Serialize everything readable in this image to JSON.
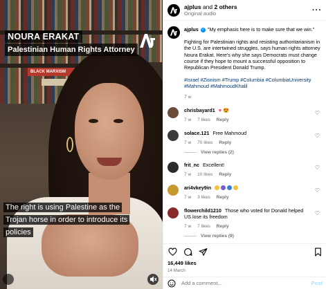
{
  "video": {
    "name_caption": "NOURA ERAKAT",
    "role_caption": "Palestinian Human Rights Attorney",
    "subtitle": "The right is using Palestine as the Trojan horse in order to introduce its policies",
    "book_spine_text": "BLACK MARXISM"
  },
  "header": {
    "username": "ajplus",
    "and_text": "and",
    "others_text": "2 others",
    "audio_label": "Original audio",
    "more_label": "···"
  },
  "post": {
    "username": "ajplus",
    "quote": "\"My emphasis here is to make sure that we win.\"",
    "body": "Fighting for Palestinian rights and resisting authoritarianism in the U.S. are intertwined struggles, says human rights attorney Noura Erakat. Here's why she says Democrats must change course if they hope to mount a successful opposition to Republican President Donald Trump.",
    "hashtags": "#Israel #Zionism #Trump #Columbia #ColumbiaUniversity #Mahmoud #MahmoudKhalil",
    "age": "7 w"
  },
  "comments": [
    {
      "user": "chrisbayard1",
      "text": "",
      "age": "7 w",
      "likes": "7 likes",
      "reply": "Reply",
      "replies": "",
      "avatar_color": "#6b4b3a"
    },
    {
      "user": "solace.121",
      "text": "Free Mahmoud",
      "age": "7 w",
      "likes": "70 likes",
      "reply": "Reply",
      "replies": "View replies (2)",
      "avatar_color": "#3a3a3a"
    },
    {
      "user": "frit_nc",
      "text": "Excellent!",
      "age": "7 w",
      "likes": "10 likes",
      "reply": "Reply",
      "replies": "",
      "avatar_color": "#2b2b2b"
    },
    {
      "user": "ari4vkey9in",
      "text": "",
      "age": "7 w",
      "likes": "3 likes",
      "reply": "Reply",
      "replies": "",
      "avatar_color": "#c49a2e"
    },
    {
      "user": "flowerchild1210",
      "text": "Those who voted for Donald helped US lose its freedom",
      "age": "7 w",
      "likes": "7 likes",
      "reply": "Reply",
      "replies": "View replies (9)",
      "avatar_color": "#8a2a2a"
    }
  ],
  "footer": {
    "likes": "16,449 likes",
    "date": "14 March",
    "comment_placeholder": "Add a comment...",
    "post_label": "Post"
  },
  "colors": {
    "link": "#00376b",
    "muted": "#737373",
    "verified": "#0095f6"
  }
}
